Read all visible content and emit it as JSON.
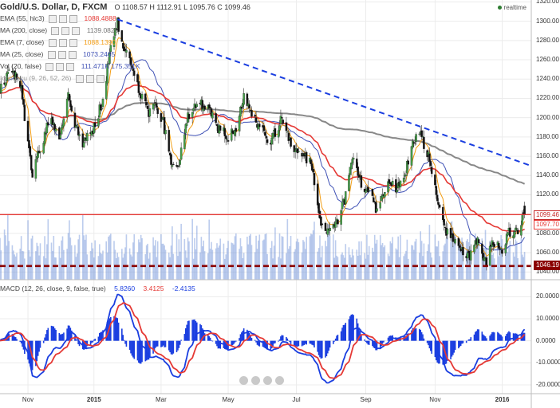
{
  "header": {
    "symbol": "Gold/U.S. Dollar, D, FXCM",
    "ohlc_line": "O 1108.57  H 1112.91  L 1095.76  C 1099.46",
    "status": "realtime"
  },
  "studies": [
    {
      "label": "EMA (55, hlc3)",
      "value": "1088.4888",
      "color": "#e53935"
    },
    {
      "label": "MA (200, close)",
      "value": "1139.0825",
      "color": "#757575"
    },
    {
      "label": "EMA (7, close)",
      "value": "1088.1390",
      "color": "#f39c12"
    },
    {
      "label": "MA (25, close)",
      "value": "1073.2465",
      "color": "#3f51b5"
    },
    {
      "label": "Vol (20, false)",
      "value": "111.471K  175.351K",
      "color": "#3f51b5"
    },
    {
      "label": "Ichimoku (9, 26, 52, 26)",
      "value": "",
      "color": "#999999"
    }
  ],
  "macd_header": {
    "label": "MACD (12, 26, close, 9, false, true)",
    "values": [
      "5.8260",
      "3.4125",
      "-2.4135"
    ]
  },
  "price_tags": {
    "close": "1099.46",
    "ema55": "1097.70",
    "support": "1046.19"
  },
  "colors": {
    "up": "#2e7d32",
    "down": "#c62828",
    "ema55": "#e53935",
    "ma200": "#888888",
    "ema7": "#f39c12",
    "ma25": "#3f51b5",
    "volume": "#6a8fd8",
    "trendline": "#1a3ee0",
    "resistance": "#e53935",
    "support": "#8b0000",
    "macd": "#1a3ee0",
    "signal": "#e53935",
    "hist": "#1a3ee0"
  },
  "chart_data": {
    "type": "candlestick",
    "title": "Gold/U.S. Dollar, D, FXCM",
    "y_ticks": [
      1040,
      1060,
      1080,
      1100,
      1120,
      1140,
      1160,
      1180,
      1200,
      1220,
      1240,
      1260,
      1280,
      1300,
      1320
    ],
    "ylim": [
      1032,
      1322
    ],
    "x_range": [
      "2014-10-09",
      "2016-01-27"
    ],
    "x_ticks": [
      {
        "label": "Nov",
        "date": "2014-11-03",
        "bold": false
      },
      {
        "label": "2015",
        "date": "2015-01-01",
        "bold": true
      },
      {
        "label": "Mar",
        "date": "2015-03-02",
        "bold": false
      },
      {
        "label": "May",
        "date": "2015-05-01",
        "bold": false
      },
      {
        "label": "Jul",
        "date": "2015-07-01",
        "bold": false
      },
      {
        "label": "Sep",
        "date": "2015-09-01",
        "bold": false
      },
      {
        "label": "Nov",
        "date": "2015-11-02",
        "bold": false
      },
      {
        "label": "2016",
        "date": "2016-01-01",
        "bold": true
      }
    ],
    "anchors": [
      [
        "2014-10-09",
        1230
      ],
      [
        "2014-10-20",
        1250
      ],
      [
        "2014-10-28",
        1228
      ],
      [
        "2014-11-04",
        1165
      ],
      [
        "2014-11-07",
        1140
      ],
      [
        "2014-11-12",
        1160
      ],
      [
        "2014-11-20",
        1190
      ],
      [
        "2014-11-24",
        1195
      ],
      [
        "2014-12-01",
        1175
      ],
      [
        "2014-12-08",
        1225
      ],
      [
        "2014-12-15",
        1195
      ],
      [
        "2014-12-22",
        1175
      ],
      [
        "2014-12-31",
        1185
      ],
      [
        "2015-01-08",
        1215
      ],
      [
        "2015-01-15",
        1265
      ],
      [
        "2015-01-22",
        1298
      ],
      [
        "2015-01-26",
        1280
      ],
      [
        "2015-02-02",
        1260
      ],
      [
        "2015-02-09",
        1235
      ],
      [
        "2015-02-18",
        1205
      ],
      [
        "2015-02-25",
        1210
      ],
      [
        "2015-03-04",
        1195
      ],
      [
        "2015-03-11",
        1155
      ],
      [
        "2015-03-17",
        1148
      ],
      [
        "2015-03-26",
        1203
      ],
      [
        "2015-04-06",
        1215
      ],
      [
        "2015-04-15",
        1205
      ],
      [
        "2015-04-23",
        1188
      ],
      [
        "2015-05-01",
        1180
      ],
      [
        "2015-05-08",
        1190
      ],
      [
        "2015-05-15",
        1225
      ],
      [
        "2015-05-22",
        1205
      ],
      [
        "2015-05-29",
        1190
      ],
      [
        "2015-06-08",
        1175
      ],
      [
        "2015-06-18",
        1200
      ],
      [
        "2015-06-26",
        1172
      ],
      [
        "2015-07-07",
        1160
      ],
      [
        "2015-07-14",
        1155
      ],
      [
        "2015-07-20",
        1105
      ],
      [
        "2015-07-24",
        1085
      ],
      [
        "2015-08-05",
        1088
      ],
      [
        "2015-08-13",
        1115
      ],
      [
        "2015-08-21",
        1160
      ],
      [
        "2015-08-28",
        1130
      ],
      [
        "2015-09-04",
        1120
      ],
      [
        "2015-09-11",
        1105
      ],
      [
        "2015-09-21",
        1130
      ],
      [
        "2015-09-29",
        1128
      ],
      [
        "2015-10-06",
        1140
      ],
      [
        "2015-10-14",
        1178
      ],
      [
        "2015-10-20",
        1180
      ],
      [
        "2015-10-28",
        1160
      ],
      [
        "2015-11-04",
        1115
      ],
      [
        "2015-11-11",
        1085
      ],
      [
        "2015-11-19",
        1075
      ],
      [
        "2015-11-26",
        1065
      ],
      [
        "2015-12-03",
        1055
      ],
      [
        "2015-12-10",
        1075
      ],
      [
        "2015-12-17",
        1050
      ],
      [
        "2015-12-24",
        1070
      ],
      [
        "2015-12-31",
        1062
      ],
      [
        "2016-01-07",
        1080
      ],
      [
        "2016-01-14",
        1082
      ],
      [
        "2016-01-21",
        1101
      ]
    ],
    "levels": {
      "resistance": 1099.46,
      "support": 1046.19
    },
    "trendline": [
      [
        "2015-01-22",
        1302
      ],
      [
        "2016-01-27",
        1150
      ]
    ],
    "volume_ylim": [
      0,
      420
    ],
    "macd": {
      "ylim": [
        -24,
        27
      ],
      "y_ticks": [
        20,
        10,
        0,
        -10,
        -20
      ],
      "y_tick_labels": [
        "20.0000",
        "10.0000",
        "0.0000",
        "-10.0000",
        "-20.0000"
      ]
    }
  }
}
